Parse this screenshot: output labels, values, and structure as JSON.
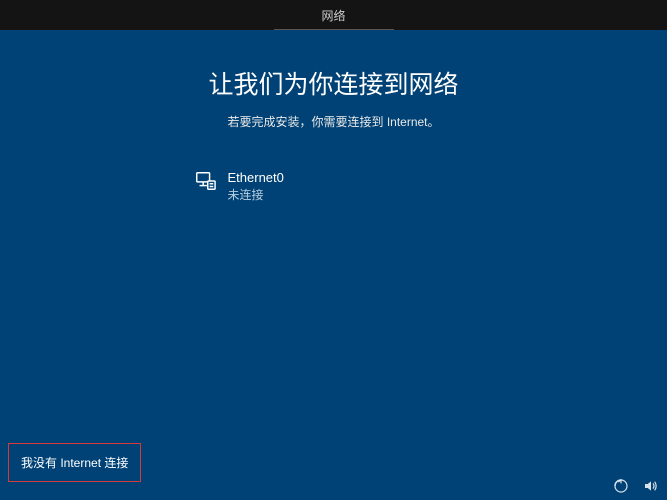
{
  "topbar": {
    "title": "网络"
  },
  "main": {
    "title": "让我们为你连接到网络",
    "subtitle": "若要完成安装，你需要连接到 Internet。"
  },
  "networks": [
    {
      "name": "Ethernet0",
      "status": "未连接"
    }
  ],
  "actions": {
    "no_internet_label": "我没有 Internet 连接"
  }
}
